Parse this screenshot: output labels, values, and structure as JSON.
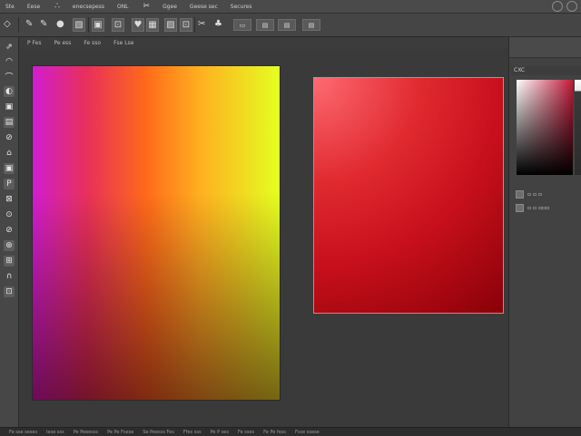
{
  "menubar": {
    "items": [
      "Ste",
      "Eese",
      "enecsepess",
      "ONL",
      "Ggee",
      "Geese sec",
      "Secures"
    ],
    "glyph_icons": [
      "scissors-icon",
      "dots-icon"
    ],
    "glyphs": [
      "✂",
      "∴"
    ]
  },
  "options_bar": {
    "icons": [
      "move-icon",
      "brush-icon",
      "blob-icon",
      "selection-icon",
      "crop-icon",
      "frame-icon",
      "heart-icon",
      "image-icon",
      "image-alt-icon",
      "scissors-icon",
      "paint-icon",
      "stack-icon",
      "arrange-icon",
      "panel-icon"
    ],
    "glyphs": [
      "◇",
      "✎",
      "●",
      "▧",
      "▣",
      "⊡",
      "♥",
      "▦",
      "▨",
      "✂",
      "♣",
      "▭",
      "▤",
      "▤"
    ]
  },
  "tabs": [
    "P Fes",
    "Pe ess",
    "Fe sso",
    "Fse Lse"
  ],
  "toolbox": {
    "tools": [
      {
        "name": "move-tool-icon",
        "glyph": "⇗"
      },
      {
        "name": "marquee-tool-icon",
        "glyph": "◠"
      },
      {
        "name": "lasso-tool-icon",
        "glyph": "⌒"
      },
      {
        "name": "quick-select-tool-icon",
        "glyph": "◐"
      },
      {
        "name": "crop-tool-icon",
        "glyph": "▣"
      },
      {
        "name": "eyedropper-tool-icon",
        "glyph": "▤"
      },
      {
        "name": "healing-tool-icon",
        "glyph": "⊘"
      },
      {
        "name": "brush-tool-icon",
        "glyph": "⌂"
      },
      {
        "name": "stamp-tool-icon",
        "glyph": "▣"
      },
      {
        "name": "history-brush-tool-icon",
        "glyph": "P"
      },
      {
        "name": "eraser-tool-icon",
        "glyph": "⊠"
      },
      {
        "name": "gradient-tool-icon",
        "glyph": "⊙"
      },
      {
        "name": "blur-tool-icon",
        "glyph": "⊘"
      },
      {
        "name": "dodge-tool-icon",
        "glyph": "⊛"
      },
      {
        "name": "pen-tool-icon",
        "glyph": "⊞"
      },
      {
        "name": "type-tool-icon",
        "glyph": "∩"
      },
      {
        "name": "shape-tool-icon",
        "glyph": "⊡"
      }
    ]
  },
  "right_panel": {
    "title": "CXC",
    "swatch_rows": [
      "▫ ▫ ▫",
      "▫ ▫ ▫▫▫"
    ]
  },
  "statusbar": {
    "items": [
      "Fe sse seses",
      "lese sss",
      "Pe Peeesss",
      "Pe Pe Fsese",
      "Se Peesss Fes",
      "Ffes sss",
      "Pe P ses",
      "Fe sses",
      "Fe Pe fess",
      "Fsse ssese"
    ]
  },
  "colors": {
    "app_bg": "#3a3a3a",
    "panel_bg": "#474747",
    "accent_red": "#c8101c"
  }
}
